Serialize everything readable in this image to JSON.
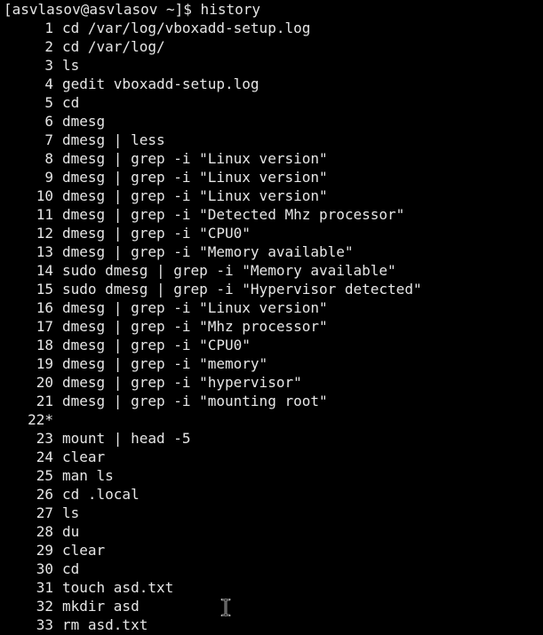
{
  "terminal": {
    "prompt": "[asvlasov@asvlasov ~]$ history",
    "colors": {
      "background": "#000000",
      "foreground": "#e6e6e6"
    },
    "history": [
      {
        "num": "1",
        "cmd": "cd /var/log/vboxadd-setup.log"
      },
      {
        "num": "2",
        "cmd": "cd /var/log/"
      },
      {
        "num": "3",
        "cmd": "ls"
      },
      {
        "num": "4",
        "cmd": "gedit vboxadd-setup.log"
      },
      {
        "num": "5",
        "cmd": "cd"
      },
      {
        "num": "6",
        "cmd": "dmesg"
      },
      {
        "num": "7",
        "cmd": "dmesg | less"
      },
      {
        "num": "8",
        "cmd": "dmesg | grep -i \"Linux version\""
      },
      {
        "num": "9",
        "cmd": "dmesg | grep -i \"Linux version\""
      },
      {
        "num": "10",
        "cmd": "dmesg | grep -i \"Linux version\""
      },
      {
        "num": "11",
        "cmd": "dmesg | grep -i \"Detected Mhz processor\""
      },
      {
        "num": "12",
        "cmd": "dmesg | grep -i \"CPU0\""
      },
      {
        "num": "13",
        "cmd": "dmesg | grep -i \"Memory available\""
      },
      {
        "num": "14",
        "cmd": "sudo dmesg | grep -i \"Memory available\""
      },
      {
        "num": "15",
        "cmd": "sudo dmesg | grep -i \"Hypervisor detected\""
      },
      {
        "num": "16",
        "cmd": "dmesg | grep -i \"Linux version\""
      },
      {
        "num": "17",
        "cmd": "dmesg | grep -i \"Mhz processor\""
      },
      {
        "num": "18",
        "cmd": "dmesg | grep -i \"CPU0\""
      },
      {
        "num": "19",
        "cmd": "dmesg | grep -i \"memory\""
      },
      {
        "num": "20",
        "cmd": "dmesg | grep -i \"hypervisor\""
      },
      {
        "num": "21",
        "cmd": "dmesg | grep -i \"mounting root\""
      },
      {
        "num": "22*",
        "cmd": ""
      },
      {
        "num": "23",
        "cmd": "mount | head -5"
      },
      {
        "num": "24",
        "cmd": "clear"
      },
      {
        "num": "25",
        "cmd": "man ls"
      },
      {
        "num": "26",
        "cmd": "cd .local"
      },
      {
        "num": "27",
        "cmd": "ls"
      },
      {
        "num": "28",
        "cmd": "du"
      },
      {
        "num": "29",
        "cmd": "clear"
      },
      {
        "num": "30",
        "cmd": "cd"
      },
      {
        "num": "31",
        "cmd": "touch asd.txt"
      },
      {
        "num": "32",
        "cmd": "mkdir asd"
      },
      {
        "num": "33",
        "cmd": "rm asd.txt"
      }
    ],
    "mouse_cursor_icon": "text-ibeam-cursor-icon"
  }
}
